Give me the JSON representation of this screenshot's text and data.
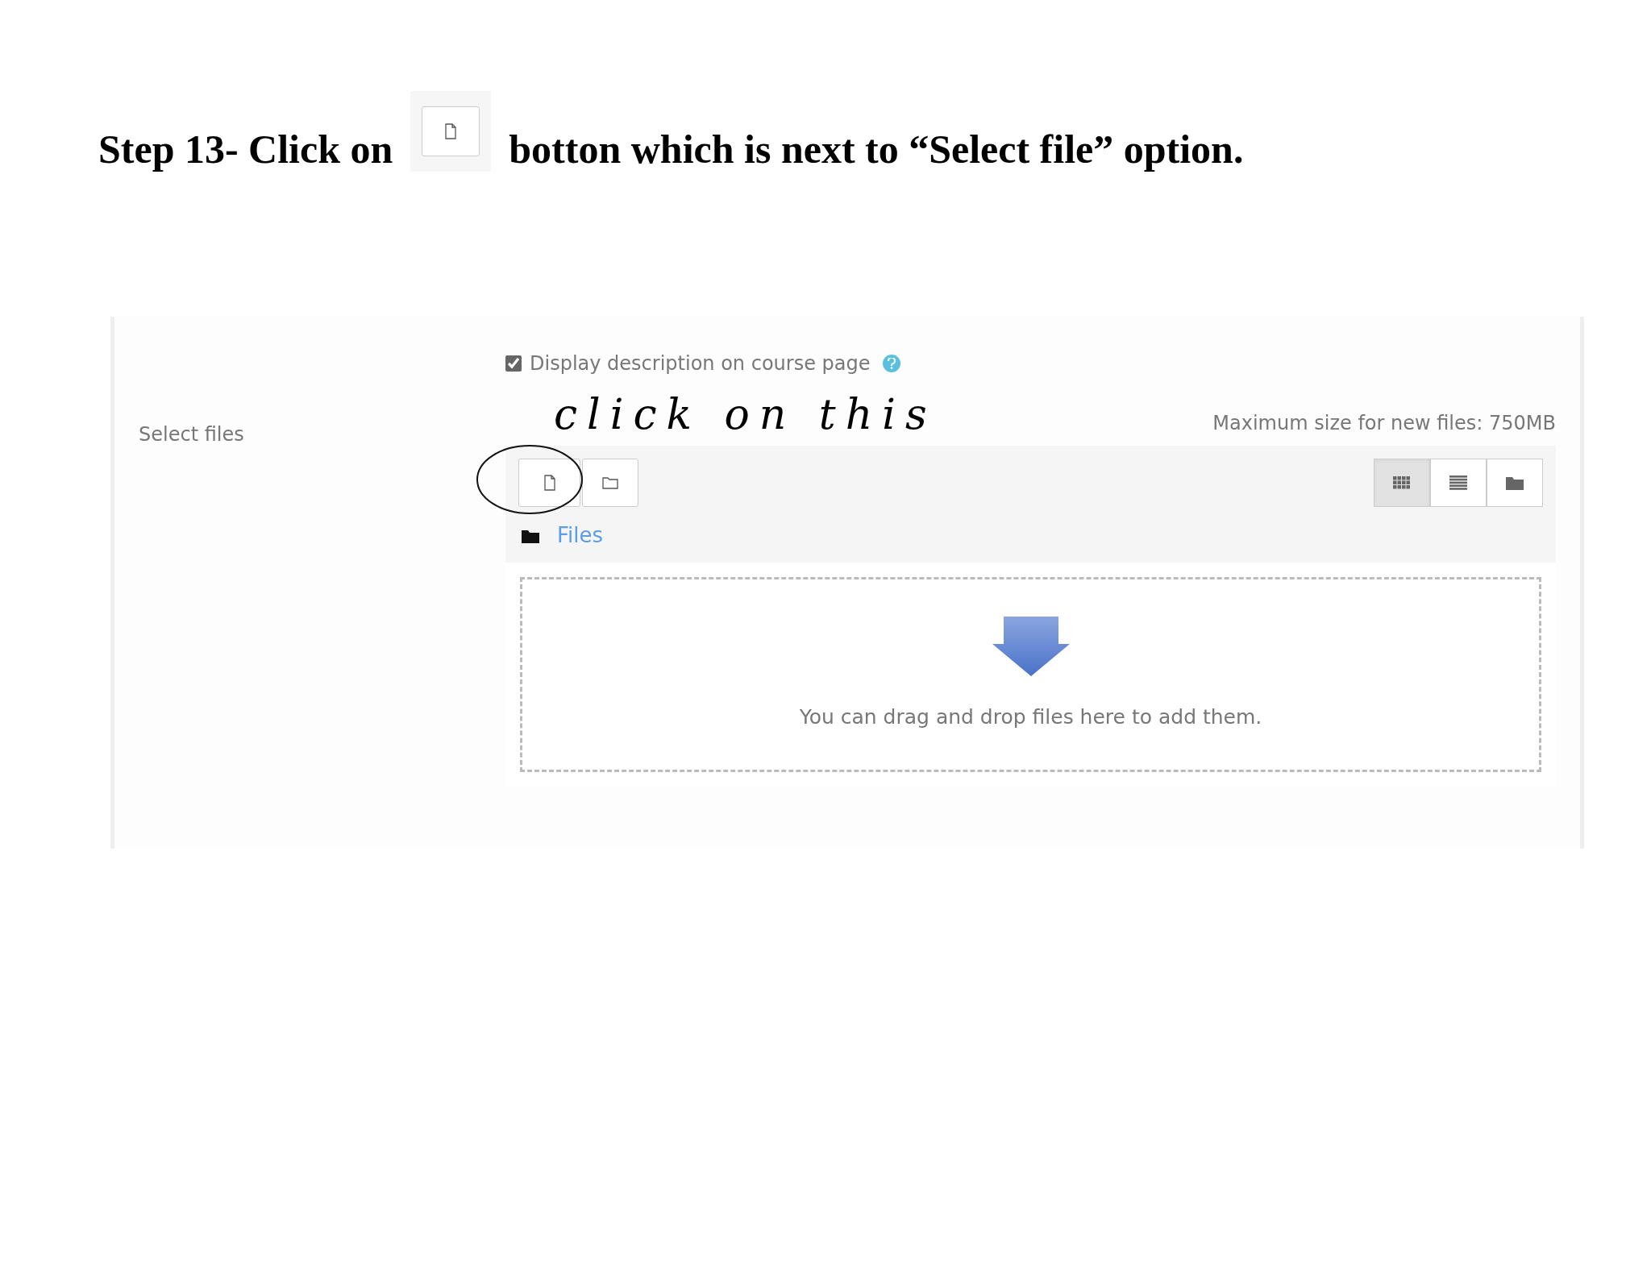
{
  "instruction": {
    "before": "Step 13- Click on",
    "after": "botton which is next to “Select file” option."
  },
  "form": {
    "description_checkbox": {
      "label": "Display description on course page",
      "checked": true
    },
    "select_files": {
      "label": "Select files",
      "max_size": "Maximum size for new files: 750MB",
      "view_buttons": [
        {
          "kind": "grid",
          "selected": true
        },
        {
          "kind": "list",
          "selected": false
        },
        {
          "kind": "tree",
          "selected": false
        }
      ],
      "path": "Files",
      "drop_hint": "You can drag and drop files here to add them."
    }
  },
  "annotation": {
    "text": "click on this"
  }
}
